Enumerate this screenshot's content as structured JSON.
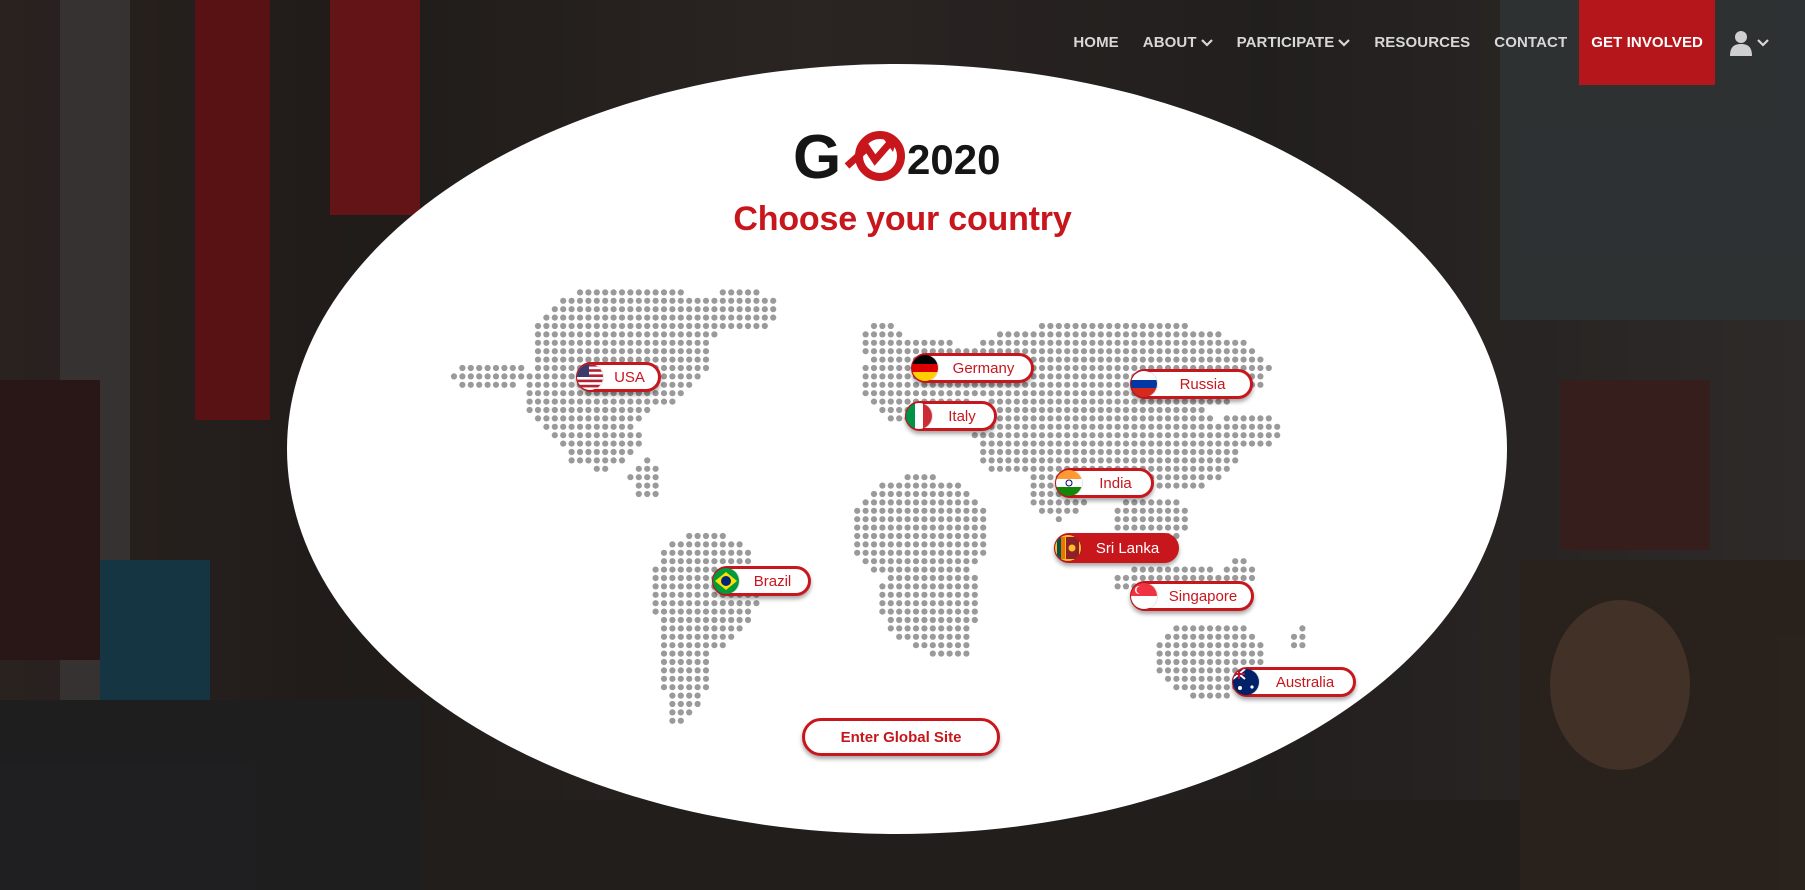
{
  "nav": {
    "home": "HOME",
    "about": "ABOUT",
    "participate": "PARTICIPATE",
    "resources": "RESOURCES",
    "contact": "CONTACT",
    "get_involved": "GET INVOLVED",
    "user_icon": "user-icon",
    "chevron_icon": "chevron-down-icon"
  },
  "logo": {
    "text": "G",
    "year": "2020"
  },
  "heading": "Choose your country",
  "countries": [
    {
      "name": "USA",
      "flag": "usa-flag-icon"
    },
    {
      "name": "Germany",
      "flag": "germany-flag-icon"
    },
    {
      "name": "Italy",
      "flag": "italy-flag-icon"
    },
    {
      "name": "Russia",
      "flag": "russia-flag-icon"
    },
    {
      "name": "India",
      "flag": "india-flag-icon"
    },
    {
      "name": "Sri Lanka",
      "flag": "sri-lanka-flag-icon",
      "selected": true
    },
    {
      "name": "Brazil",
      "flag": "brazil-flag-icon"
    },
    {
      "name": "Singapore",
      "flag": "singapore-flag-icon"
    },
    {
      "name": "Australia",
      "flag": "australia-flag-icon"
    }
  ],
  "global_button": "Enter Global Site",
  "colors": {
    "brand_red": "#c8161d",
    "nav_cta": "#b5161c",
    "map_dot": "#9a9a9a"
  }
}
